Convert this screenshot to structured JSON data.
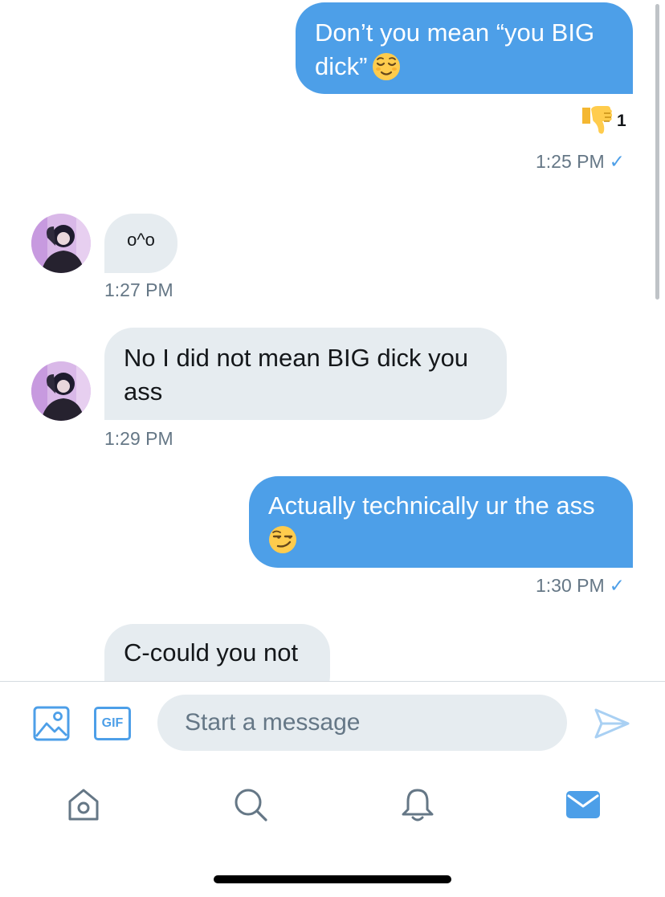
{
  "messages": [
    {
      "direction": "outgoing",
      "lines": [
        "Don’t you mean “you BIG",
        "dick”"
      ],
      "emoji": "relieved-face",
      "reaction": {
        "emoji": "thumbs-down",
        "count": "1"
      },
      "time": "1:25 PM"
    },
    {
      "direction": "incoming",
      "lines": [
        "o^o"
      ],
      "time": "1:27 PM"
    },
    {
      "direction": "incoming",
      "lines": [
        "No I did not mean BIG dick you",
        "ass"
      ],
      "time": "1:29 PM"
    },
    {
      "direction": "outgoing",
      "lines": [
        "Actually technically ur the ass"
      ],
      "emoji": "smirking-face",
      "time": "1:30 PM"
    },
    {
      "direction": "incoming",
      "lines": [
        "C-could you not"
      ]
    }
  ],
  "composer": {
    "placeholder": "Start a message",
    "value": "",
    "gif_label": "GIF"
  },
  "icons": {
    "image": "image-icon",
    "gif": "gif-icon",
    "send": "send-icon",
    "home": "home-icon",
    "search": "search-icon",
    "notifications": "bell-icon",
    "messages": "mail-icon"
  },
  "colors": {
    "outgoing_bubble": "#4d9fe8",
    "incoming_bubble": "#e6ecf0",
    "accent": "#4d9fe8",
    "timestamp": "#657786",
    "inactive_icon": "#657786"
  }
}
